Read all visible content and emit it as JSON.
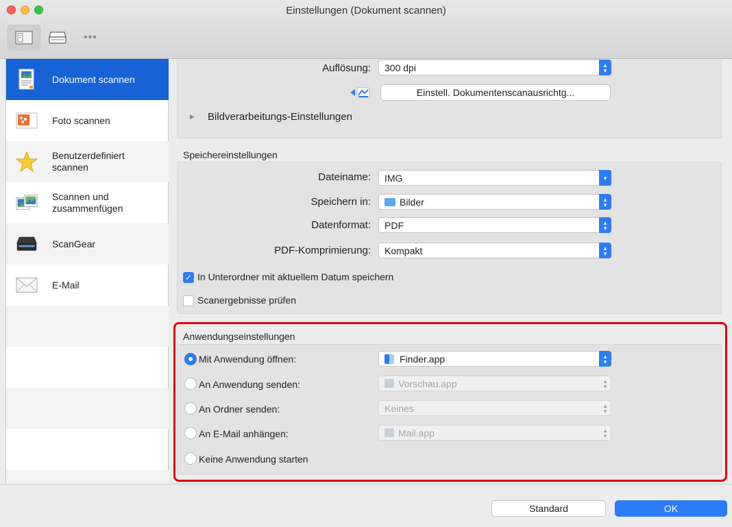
{
  "window": {
    "title": "Einstellungen (Dokument scannen)"
  },
  "toolbar": {
    "more_label": "•••"
  },
  "sidebar": {
    "items": [
      {
        "label": "Dokument scannen",
        "icon": "document-scan-icon"
      },
      {
        "label": "Foto scannen",
        "icon": "photo-scan-icon"
      },
      {
        "label": "Benutzerdefiniert scannen",
        "icon": "star-icon"
      },
      {
        "label": "Scannen und zusammenfügen",
        "icon": "stitch-icon"
      },
      {
        "label": "ScanGear",
        "icon": "scanner-icon"
      },
      {
        "label": "E-Mail",
        "icon": "envelope-icon"
      }
    ]
  },
  "scan_settings": {
    "resolution_label": "Auflösung:",
    "resolution_value": "300 dpi",
    "alignment_button": "Einstell. Dokumentenscanausrichtg...",
    "image_processing_label": "Bildverarbeitungs-Einstellungen"
  },
  "save_settings": {
    "title": "Speichereinstellungen",
    "filename_label": "Dateiname:",
    "filename_value": "IMG",
    "save_in_label": "Speichern in:",
    "save_in_value": "Bilder",
    "format_label": "Datenformat:",
    "format_value": "PDF",
    "compression_label": "PDF-Komprimierung:",
    "compression_value": "Kompakt",
    "subfolder_label": "In Unterordner mit aktuellem Datum speichern",
    "subfolder_checked": true,
    "check_results_label": "Scanergebnisse prüfen",
    "check_results_checked": false
  },
  "app_settings": {
    "title": "Anwendungseinstellungen",
    "options": [
      {
        "label": "Mit Anwendung öffnen:",
        "value": "Finder.app",
        "selected": true
      },
      {
        "label": "An Anwendung senden:",
        "value": "Vorschau.app",
        "selected": false
      },
      {
        "label": "An Ordner senden:",
        "value": "Keines",
        "selected": false
      },
      {
        "label": "An E-Mail anhängen:",
        "value": "Mail.app",
        "selected": false
      },
      {
        "label": "Keine Anwendung starten",
        "value": "",
        "selected": false
      }
    ]
  },
  "footer": {
    "standard_label": "Standard",
    "ok_label": "OK"
  },
  "colors": {
    "accent": "#2d7cf6",
    "selection": "#1662d6",
    "highlight": "#e1000f"
  }
}
